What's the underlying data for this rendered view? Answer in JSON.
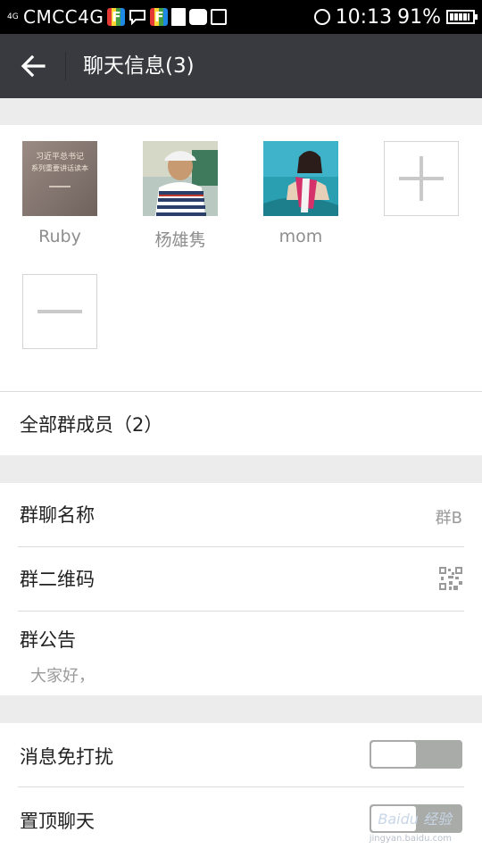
{
  "status_bar": {
    "signal": "4G",
    "carrier": "CMCC4G",
    "time": "10:13",
    "battery": "91%",
    "icons": [
      "signal-icon",
      "f-app-icon",
      "sms-icon",
      "f-app-icon",
      "document-icon",
      "message-icon",
      "camera-icon",
      "alarm-icon",
      "battery-icon"
    ]
  },
  "header": {
    "title": "聊天信息(3)",
    "back_icon": "back-arrow-icon"
  },
  "members": [
    {
      "name": "Ruby",
      "avatar": "book-cover-avatar",
      "cover_text_1": "习近平总书记",
      "cover_text_2": "系列重要讲话读本"
    },
    {
      "name": "杨雄隽",
      "avatar": "man-in-striped-shirt-avatar"
    },
    {
      "name": "mom",
      "avatar": "woman-on-beach-avatar"
    }
  ],
  "add_member_icon": "plus-icon",
  "remove_member_icon": "minus-icon",
  "all_members": {
    "label": "全部群成员（2）"
  },
  "group_name": {
    "label": "群聊名称",
    "value": "群B"
  },
  "qr_code": {
    "label": "群二维码",
    "icon": "qr-code-icon"
  },
  "announcement": {
    "label": "群公告",
    "text": "大家好，"
  },
  "mute": {
    "label": "消息免打扰",
    "on": false
  },
  "pin": {
    "label": "置顶聊天",
    "on": false
  },
  "watermark": {
    "text": "Baidu 经验",
    "url": "jingyan.baidu.com"
  },
  "colors": {
    "header_bg": "#393a3f",
    "page_bg": "#ececec",
    "switch_bg": "#a8aba7"
  }
}
